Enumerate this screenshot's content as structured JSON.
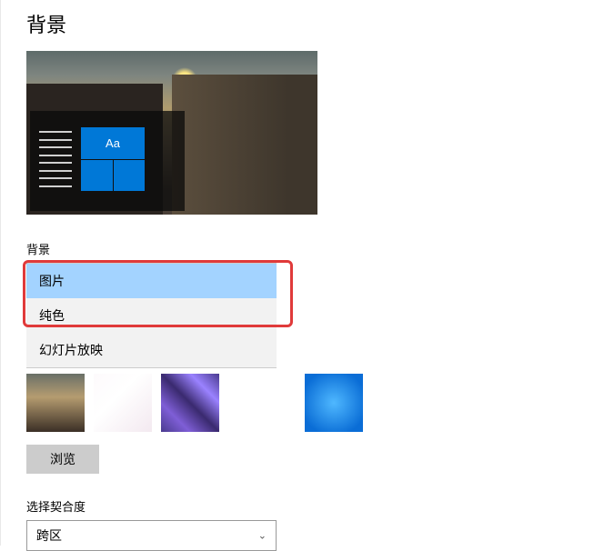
{
  "title": "背景",
  "preview_tile_text": "Aa",
  "background": {
    "label": "背景",
    "options": [
      "图片",
      "纯色",
      "幻灯片放映"
    ],
    "selected_index": 0
  },
  "browse_label": "浏览",
  "fit": {
    "label": "选择契合度",
    "selected": "跨区"
  }
}
